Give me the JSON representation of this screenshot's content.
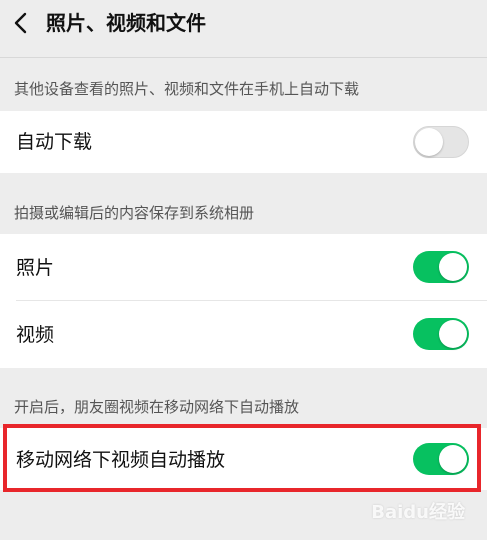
{
  "header": {
    "title": "照片、视频和文件",
    "back_icon": "chevron-left-icon"
  },
  "sections": [
    {
      "description": "其他设备查看的照片、视频和文件在手机上自动下载",
      "items": [
        {
          "label": "自动下载",
          "toggle": "off"
        }
      ]
    },
    {
      "description": "拍摄或编辑后的内容保存到系统相册",
      "items": [
        {
          "label": "照片",
          "toggle": "on"
        },
        {
          "label": "视频",
          "toggle": "on"
        }
      ]
    },
    {
      "description": "开启后，朋友圈视频在移动网络下自动播放",
      "items": [
        {
          "label": "移动网络下视频自动播放",
          "toggle": "on"
        }
      ]
    }
  ],
  "colors": {
    "background": "#ededed",
    "toggle_on": "#07c160",
    "toggle_off": "#e5e5e5",
    "highlight": "#e8262b"
  },
  "watermark": "Baidu经验"
}
